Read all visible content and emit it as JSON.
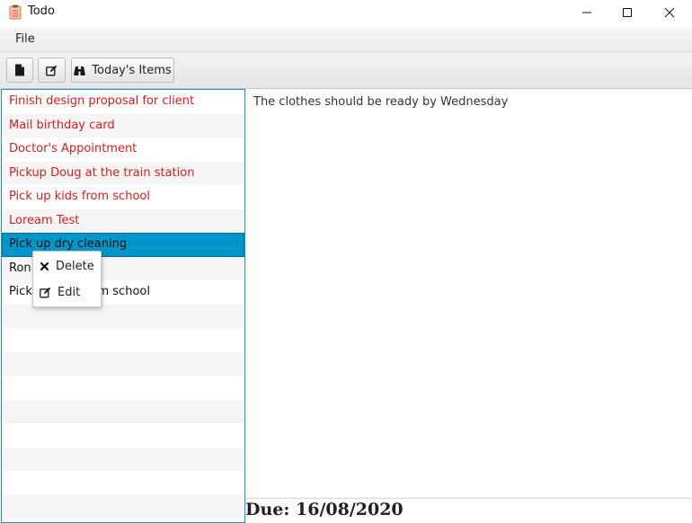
{
  "window": {
    "title": "Todo"
  },
  "menu": {
    "file": "File"
  },
  "toolbar": {
    "new_icon": "document-icon",
    "edit_icon": "edit-icon",
    "today_icon": "binoculars-icon",
    "today_label": "Today's Items"
  },
  "todo_list": {
    "items": [
      {
        "label": "Finish design proposal for client",
        "color": "#e01b1b"
      },
      {
        "label": "Mail birthday card",
        "color": "#e01b1b"
      },
      {
        "label": "Doctor's Appointment",
        "color": "#e01b1b"
      },
      {
        "label": "Pickup Doug at the train station",
        "color": "#e01b1b"
      },
      {
        "label": "Pick up kids from school",
        "color": "#e01b1b"
      },
      {
        "label": "Loream Test",
        "color": "#e01b1b"
      },
      {
        "label": "Pick up dry cleaning",
        "selected": true
      },
      {
        "label": "Ron"
      },
      {
        "label": "Pick up kids from school"
      }
    ],
    "accent_color": "#0096c9"
  },
  "details": {
    "text": "The clothes should be ready by Wednesday",
    "due": "Due: 16/08/2020"
  },
  "context_menu": {
    "delete_label": "Delete",
    "delete_icon": "close-icon",
    "edit_label": "Edit",
    "edit_icon": "edit-icon"
  }
}
